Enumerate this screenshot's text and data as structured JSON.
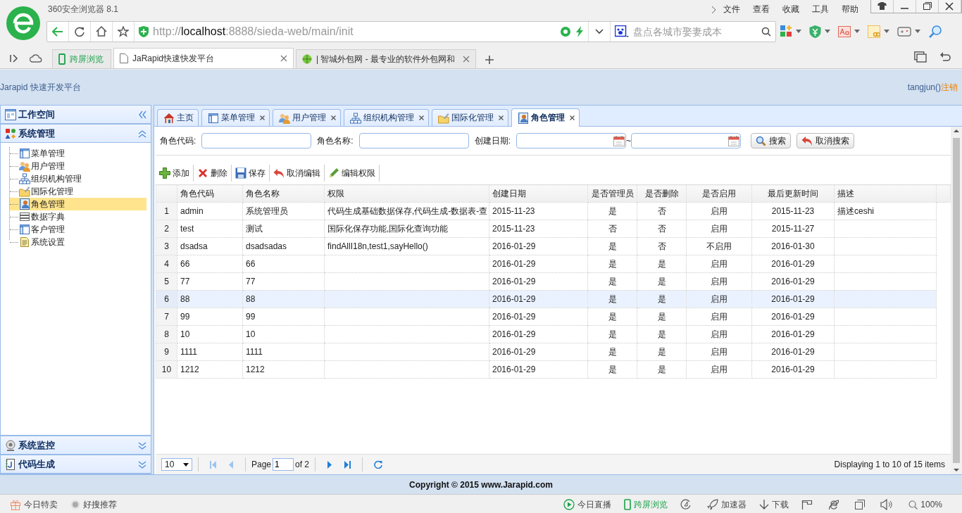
{
  "browser": {
    "title": "360安全浏览器 8.1",
    "menu": [
      "文件",
      "查看",
      "收藏",
      "工具",
      "帮助"
    ],
    "address": {
      "scheme": "http://",
      "host": "localhost",
      "path": ":8888/sieda-web/main/init"
    },
    "search": {
      "placeholder": "盘点各城市娶妻成本"
    },
    "tabs": [
      {
        "label": "跨屏浏览",
        "kind": "feature",
        "selected": false
      },
      {
        "label": "JaRapid快速快发平台",
        "kind": "page",
        "selected": true
      },
      {
        "label": "| 智城外包网 - 最专业的软件外包网和",
        "kind": "page",
        "selected": false
      }
    ],
    "status_left": [
      "今日特卖",
      "好搜推荐"
    ],
    "status_right": [
      {
        "label": "今日直播",
        "kind": "plain"
      },
      {
        "label": "跨屏浏览",
        "kind": "feature"
      },
      {
        "label": "加速器",
        "kind": "plain"
      },
      {
        "label": "下载",
        "kind": "plain"
      }
    ],
    "zoom": "100%"
  },
  "app": {
    "title": "Jarapid 快速开发平台",
    "user": "tangjun()",
    "logout": "注销"
  },
  "sidebar": {
    "workspace": "工作空间",
    "panels": [
      {
        "title": "系统管理",
        "expanded": true,
        "children": [
          {
            "label": "菜单管理",
            "selected": false
          },
          {
            "label": "用户管理",
            "selected": false
          },
          {
            "label": "组织机构管理",
            "selected": false
          },
          {
            "label": "国际化管理",
            "selected": false
          },
          {
            "label": "角色管理",
            "selected": true
          },
          {
            "label": "数据字典",
            "selected": false
          },
          {
            "label": "客户管理",
            "selected": false
          },
          {
            "label": "系统设置",
            "selected": false
          }
        ]
      },
      {
        "title": "系统监控",
        "expanded": false
      },
      {
        "title": "代码生成",
        "expanded": false
      }
    ]
  },
  "tabs": [
    {
      "label": "主页",
      "closable": false,
      "selected": false
    },
    {
      "label": "菜单管理",
      "closable": true,
      "selected": false
    },
    {
      "label": "用户管理",
      "closable": true,
      "selected": false
    },
    {
      "label": "组织机构管理",
      "closable": true,
      "selected": false
    },
    {
      "label": "国际化管理",
      "closable": true,
      "selected": false
    },
    {
      "label": "角色管理",
      "closable": true,
      "selected": true
    }
  ],
  "search_form": {
    "fields": [
      {
        "label": "角色代码:",
        "kind": "text"
      },
      {
        "label": "角色名称:",
        "kind": "text"
      },
      {
        "label": "创建日期:",
        "kind": "daterange"
      }
    ],
    "separator": "~",
    "buttons": [
      "搜索",
      "取消搜索"
    ]
  },
  "toolbar": [
    "添加",
    "删除",
    "保存",
    "取消编辑",
    "编辑权限"
  ],
  "table": {
    "columns": [
      "角色代码",
      "角色名称",
      "权限",
      "创建日期",
      "是否管理员",
      "是否删除",
      "是否启用",
      "最后更新时间",
      "描述"
    ],
    "rows": [
      {
        "number": "1",
        "code": "admin",
        "name": "系统管理员",
        "permissions": "代码生成基础数据保存,代码生成-数据表-查",
        "created": "2015-11-23",
        "admin": "是",
        "deleted": "否",
        "enabled": "启用",
        "updated": "2015-11-23",
        "description": "描述ceshi",
        "selected": false
      },
      {
        "number": "2",
        "code": "test",
        "name": "测试",
        "permissions": "国际化保存功能,国际化查询功能",
        "created": "2015-11-23",
        "admin": "否",
        "deleted": "否",
        "enabled": "启用",
        "updated": "2015-11-27",
        "selected": false
      },
      {
        "number": "3",
        "code": "dsadsa",
        "name": "dsadsadas",
        "permissions": "findAllI18n,test1,sayHello()",
        "created": "2016-01-29",
        "admin": "是",
        "deleted": "否",
        "enabled": "不启用",
        "updated": "2016-01-30",
        "selected": false
      },
      {
        "number": "4",
        "code": "66",
        "name": "66",
        "created": "2016-01-29",
        "admin": "是",
        "deleted": "是",
        "enabled": "启用",
        "updated": "2016-01-29",
        "selected": false
      },
      {
        "number": "5",
        "code": "77",
        "name": "77",
        "created": "2016-01-29",
        "admin": "是",
        "deleted": "是",
        "enabled": "启用",
        "updated": "2016-01-29",
        "selected": false
      },
      {
        "number": "6",
        "code": "88",
        "name": "88",
        "created": "2016-01-29",
        "admin": "是",
        "deleted": "是",
        "enabled": "启用",
        "updated": "2016-01-29",
        "selected": true
      },
      {
        "number": "7",
        "code": "99",
        "name": "99",
        "created": "2016-01-29",
        "admin": "是",
        "deleted": "是",
        "enabled": "启用",
        "updated": "2016-01-29",
        "selected": false
      },
      {
        "number": "8",
        "code": "10",
        "name": "10",
        "created": "2016-01-29",
        "admin": "是",
        "deleted": "是",
        "enabled": "启用",
        "updated": "2016-01-29",
        "selected": false
      },
      {
        "number": "9",
        "code": "1111",
        "name": "1111",
        "created": "2016-01-29",
        "admin": "是",
        "deleted": "是",
        "enabled": "启用",
        "updated": "2016-01-29",
        "selected": false
      },
      {
        "number": "10",
        "code": "1212",
        "name": "1212",
        "created": "2016-01-29",
        "admin": "是",
        "deleted": "是",
        "enabled": "启用",
        "updated": "2016-01-29",
        "selected": false
      }
    ]
  },
  "pager": {
    "page_size": "10",
    "page_label": "Page",
    "page": "1",
    "of": "of 2",
    "summary": "Displaying 1 to 10 of 15 items"
  },
  "footer": "Copyright © 2015 www.Jarapid.com"
}
